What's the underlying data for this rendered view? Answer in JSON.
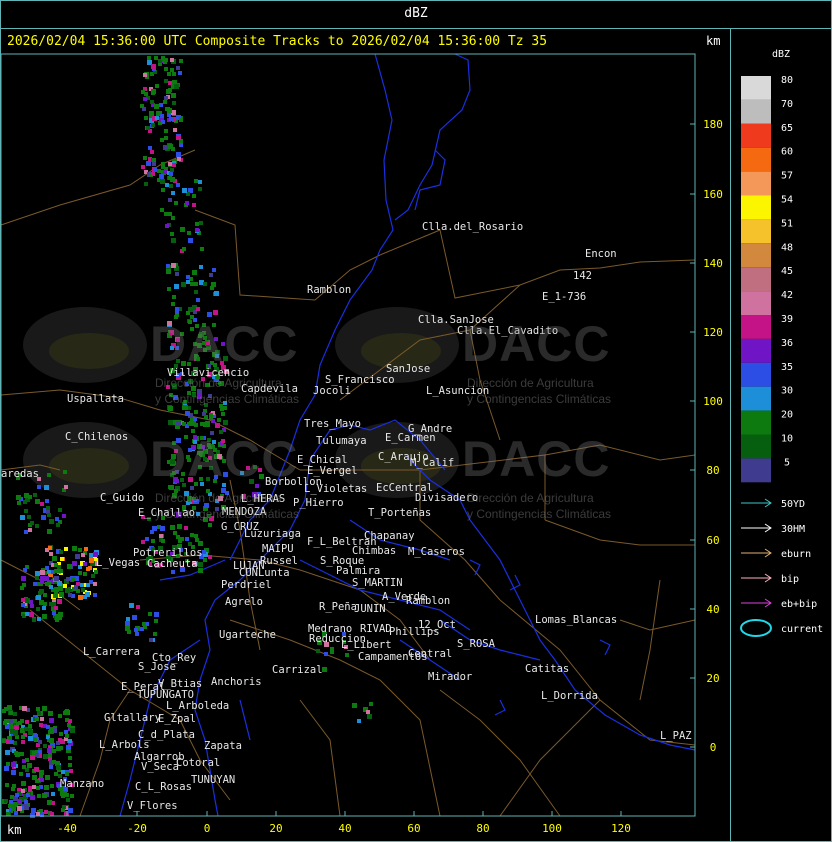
{
  "header": {
    "title": "dBZ",
    "subtitle": "2026/02/04 15:36:00 UTC Composite Tracks to 2026/02/04 15:36:00 Tz 35",
    "km_right": "km",
    "km_bottom": "km"
  },
  "watermark": {
    "brand": "DACC",
    "line1": "Dirección de Agricultura",
    "line2": "y Contingencias Climáticas"
  },
  "y_axis": {
    "ticks": [
      "180",
      "160",
      "140",
      "120",
      "100",
      "80",
      "60",
      "40",
      "20",
      "0"
    ]
  },
  "x_axis": {
    "ticks": [
      "-40",
      "-20",
      "0",
      "20",
      "40",
      "60",
      "80",
      "100",
      "120"
    ]
  },
  "legend": {
    "title": "dBZ",
    "levels": [
      {
        "label": "80",
        "color": "#d9d9d9"
      },
      {
        "label": "70",
        "color": "#bdbdbd"
      },
      {
        "label": "65",
        "color": "#f03a1e"
      },
      {
        "label": "60",
        "color": "#f56a10"
      },
      {
        "label": "57",
        "color": "#f4985a"
      },
      {
        "label": "54",
        "color": "#fbf500"
      },
      {
        "label": "51",
        "color": "#f6c22c"
      },
      {
        "label": "48",
        "color": "#d2893e"
      },
      {
        "label": "45",
        "color": "#c06f80"
      },
      {
        "label": "42",
        "color": "#d0729f"
      },
      {
        "label": "39",
        "color": "#c31387"
      },
      {
        "label": "36",
        "color": "#6f15c6"
      },
      {
        "label": "35",
        "color": "#2c4ee5"
      },
      {
        "label": "30",
        "color": "#1c8fd8"
      },
      {
        "label": "20",
        "color": "#0d7a10"
      },
      {
        "label": "10",
        "color": "#065f0e"
      },
      {
        "label": "5",
        "color": "#3f3b8e"
      }
    ],
    "tracks": [
      {
        "label": "50YD",
        "color": "#3cc8c8"
      },
      {
        "label": "30HM",
        "color": "#ffffff"
      },
      {
        "label": "eburn",
        "color": "#e0b070"
      },
      {
        "label": "bip",
        "color": "#ffb0c0"
      },
      {
        "label": "eb+bip",
        "color": "#e040e0"
      },
      {
        "label": "current",
        "color": "#20d8e8"
      }
    ]
  },
  "places": [
    {
      "name": "Clla.del_Rosario"
    },
    {
      "name": "Encon"
    },
    {
      "name": "Ramblon"
    },
    {
      "name": "142"
    },
    {
      "name": "E_1-736"
    },
    {
      "name": "Clla.SanJose"
    },
    {
      "name": "Clla.El_Cavadito"
    },
    {
      "name": "Villavicencio"
    },
    {
      "name": "Capdevila"
    },
    {
      "name": "S_Francisco"
    },
    {
      "name": "SanJose"
    },
    {
      "name": "Jocoli"
    },
    {
      "name": "L_Asuncion"
    },
    {
      "name": "Uspallata"
    },
    {
      "name": "Tres_Mayo"
    },
    {
      "name": "E_Carmen"
    },
    {
      "name": "G_Andre"
    },
    {
      "name": "C_Chilenos"
    },
    {
      "name": "Tulumaya"
    },
    {
      "name": "E_Chical"
    },
    {
      "name": "C_Araujo"
    },
    {
      "name": "M_Calif"
    },
    {
      "name": "aredas"
    },
    {
      "name": "E_Vergel"
    },
    {
      "name": "Borbollon"
    },
    {
      "name": "EcCentral"
    },
    {
      "name": "L_Violetas"
    },
    {
      "name": "Divisadero"
    },
    {
      "name": "C_Guido"
    },
    {
      "name": "L_HERAS"
    },
    {
      "name": "P_Hierro"
    },
    {
      "name": "E_Challao"
    },
    {
      "name": "MENDOZA"
    },
    {
      "name": "T_Porteñas"
    },
    {
      "name": "G_CRUZ"
    },
    {
      "name": "Luzuriaga"
    },
    {
      "name": "Chapanay"
    },
    {
      "name": "F_L_Beltran"
    },
    {
      "name": "MAIPU"
    },
    {
      "name": "Chimbas"
    },
    {
      "name": "M_Caseros"
    },
    {
      "name": "Potrerillos"
    },
    {
      "name": "Russel"
    },
    {
      "name": "S_Roque"
    },
    {
      "name": "L_Vegas"
    },
    {
      "name": "Cacheuta"
    },
    {
      "name": "LUJAN"
    },
    {
      "name": "CUNLunta"
    },
    {
      "name": "Palmira"
    },
    {
      "name": "S_MARTIN"
    },
    {
      "name": "Perdriel"
    },
    {
      "name": "A_Verde"
    },
    {
      "name": "Agrelo"
    },
    {
      "name": "R_Peña"
    },
    {
      "name": "JUNIN"
    },
    {
      "name": "Ramblon"
    },
    {
      "name": "Lomas_Blancas"
    },
    {
      "name": "Ugarteche"
    },
    {
      "name": "Medrano"
    },
    {
      "name": "RIVAD"
    },
    {
      "name": "Phillips"
    },
    {
      "name": "12_Oct"
    },
    {
      "name": "Reduccion"
    },
    {
      "name": "S_ROSA"
    },
    {
      "name": "L_Libert"
    },
    {
      "name": "L_Carrera"
    },
    {
      "name": "Cto_Rey"
    },
    {
      "name": "Campamentos"
    },
    {
      "name": "Central"
    },
    {
      "name": "S_Jose"
    },
    {
      "name": "Carrizal"
    },
    {
      "name": "Catitas"
    },
    {
      "name": "V_Btias"
    },
    {
      "name": "Anchoris"
    },
    {
      "name": "E_Peral"
    },
    {
      "name": "Mirador"
    },
    {
      "name": "TUPUNGATO"
    },
    {
      "name": "L_Dorrida"
    },
    {
      "name": "L_Arboleda"
    },
    {
      "name": "Gltallary"
    },
    {
      "name": "E_Zpal"
    },
    {
      "name": "C_d_Plata"
    },
    {
      "name": "L_PAZ"
    },
    {
      "name": "L_Arbols"
    },
    {
      "name": "Zapata"
    },
    {
      "name": "Algarrob"
    },
    {
      "name": "V_Seca"
    },
    {
      "name": "Cotoral"
    },
    {
      "name": "TUNUYAN"
    },
    {
      "name": "Manzano"
    },
    {
      "name": "C_L_Rosas"
    },
    {
      "name": "V_Flores"
    }
  ]
}
